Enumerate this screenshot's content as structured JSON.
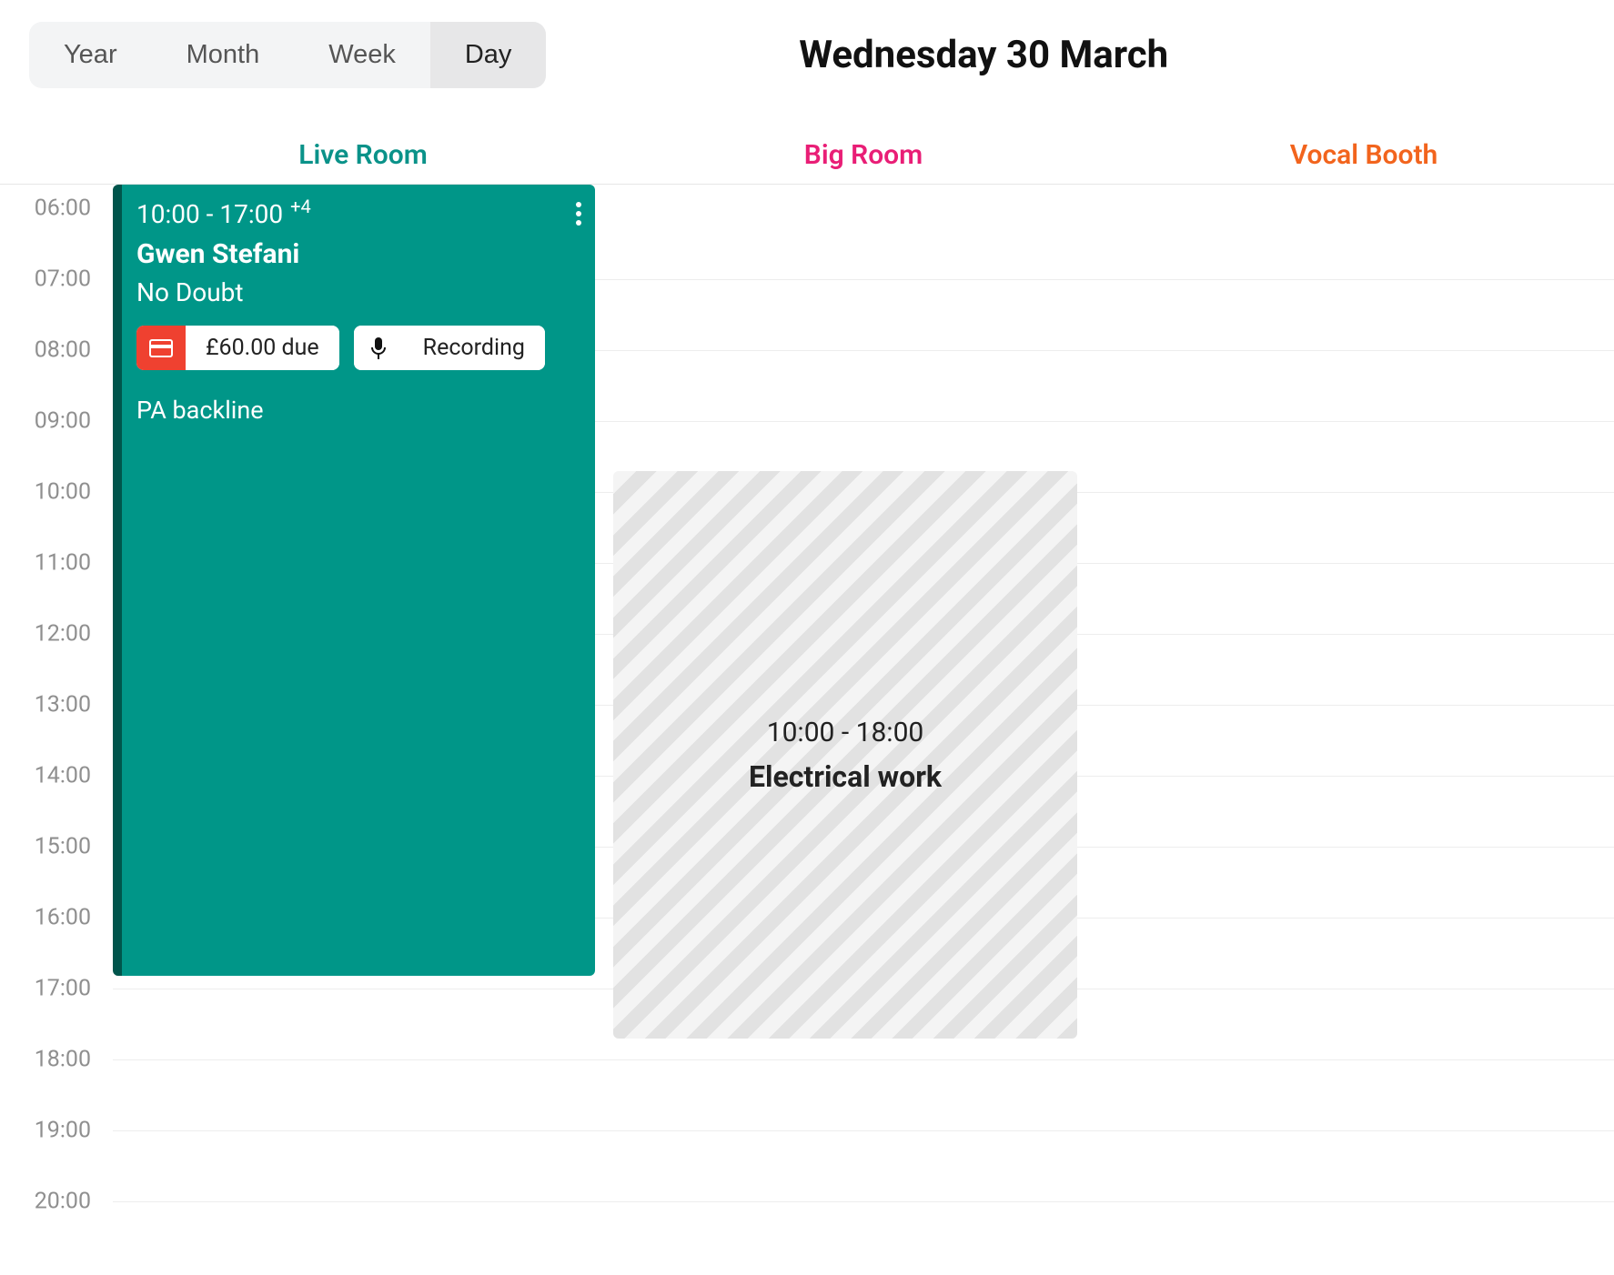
{
  "views": {
    "year": "Year",
    "month": "Month",
    "week": "Week",
    "day": "Day",
    "active": "day"
  },
  "date_title": "Wednesday 30 March",
  "rooms": [
    {
      "name": "Live Room",
      "color": "#0a9289"
    },
    {
      "name": "Big Room",
      "color": "#e91e76"
    },
    {
      "name": "Vocal Booth",
      "color": "#f2641d"
    }
  ],
  "hours": [
    "06:00",
    "07:00",
    "08:00",
    "09:00",
    "10:00",
    "11:00",
    "12:00",
    "13:00",
    "14:00",
    "15:00",
    "16:00",
    "17:00",
    "18:00",
    "19:00",
    "20:00"
  ],
  "events": {
    "live_room_booking": {
      "time": "10:00 - 17:00",
      "plus": "+4",
      "artist": "Gwen Stefani",
      "band": "No Doubt",
      "due_label": "£60.00 due",
      "session_type": "Recording",
      "notes": "PA backline"
    },
    "big_room_block": {
      "time": "10:00 - 18:00",
      "title": "Electrical work"
    }
  }
}
